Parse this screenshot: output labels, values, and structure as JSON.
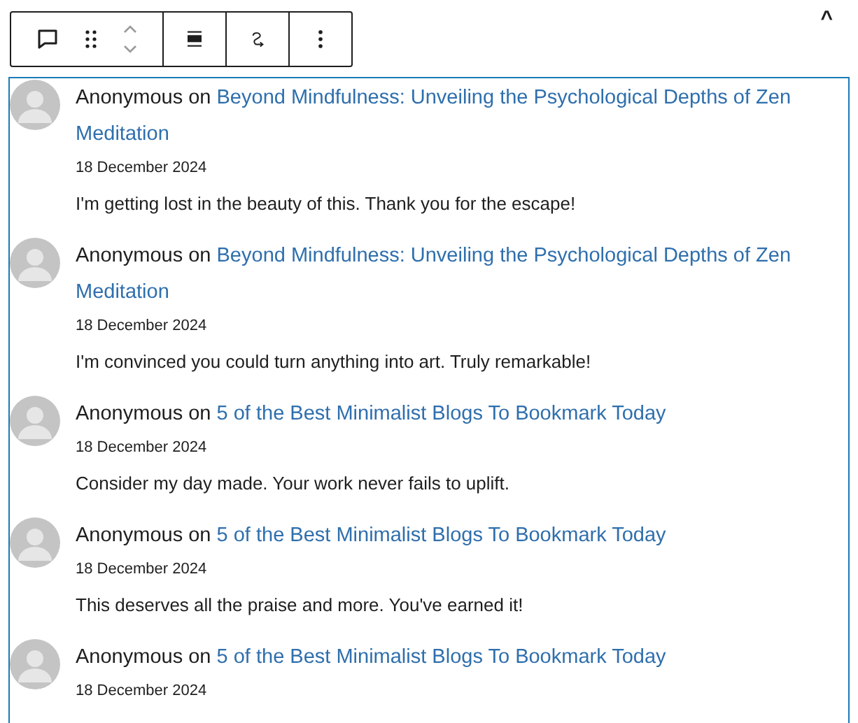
{
  "toolbar": {
    "collapse_label": "^"
  },
  "comments": [
    {
      "author": "Anonymous",
      "connector": "on",
      "post": "Beyond Mindfulness: Unveiling the Psychological Depths of Zen Meditation",
      "date": "18 December 2024",
      "text": "I'm getting lost in the beauty of this. Thank you for the escape!"
    },
    {
      "author": "Anonymous",
      "connector": "on",
      "post": "Beyond Mindfulness: Unveiling the Psychological Depths of Zen Meditation",
      "date": "18 December 2024",
      "text": "I'm convinced you could turn anything into art. Truly remarkable!"
    },
    {
      "author": "Anonymous",
      "connector": "on",
      "post": "5 of the Best Minimalist Blogs To Bookmark Today",
      "date": "18 December 2024",
      "text": "Consider my day made. Your work never fails to uplift."
    },
    {
      "author": "Anonymous",
      "connector": "on",
      "post": "5 of the Best Minimalist Blogs To Bookmark Today",
      "date": "18 December 2024",
      "text": "This deserves all the praise and more. You've earned it!"
    },
    {
      "author": "Anonymous",
      "connector": "on",
      "post": "5 of the Best Minimalist Blogs To Bookmark Today",
      "date": "18 December 2024"
    }
  ]
}
